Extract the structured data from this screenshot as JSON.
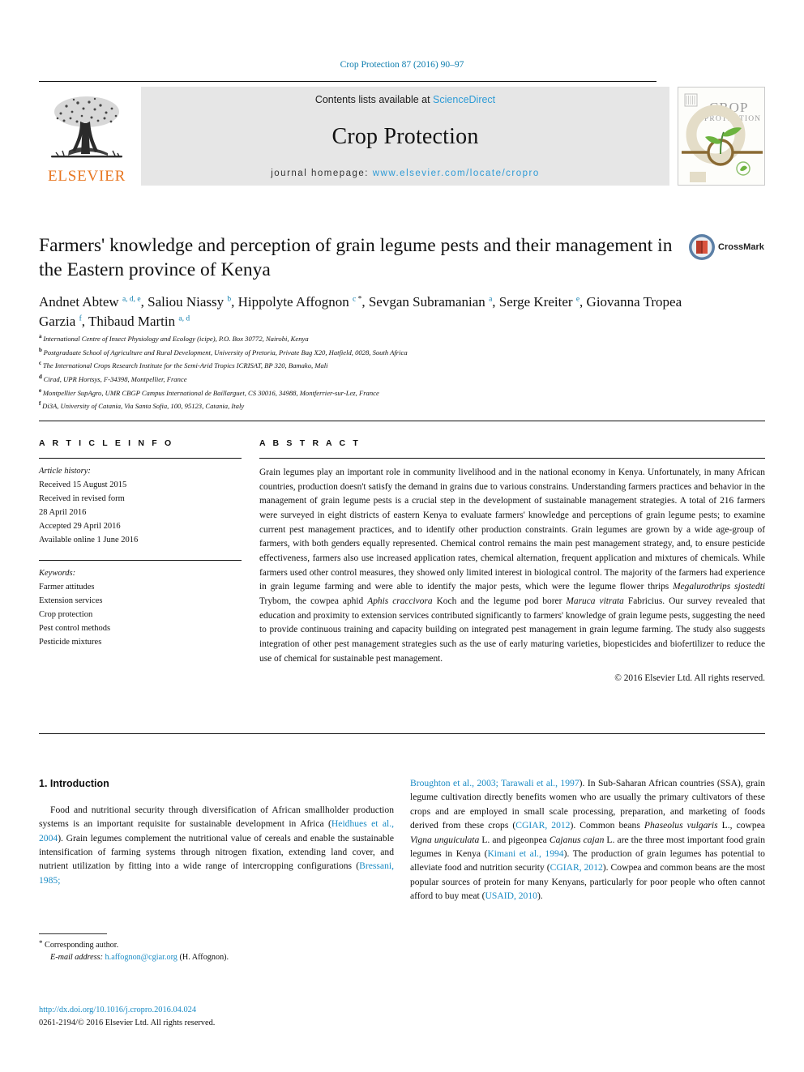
{
  "running_head": "Crop Protection 87 (2016) 90–97",
  "masthead": {
    "contents_prefix": "Contents lists available at ",
    "sciencedirect": "ScienceDirect",
    "journal_name": "Crop Protection",
    "homepage_prefix": "journal homepage: ",
    "homepage_url": "www.elsevier.com/locate/cropro",
    "publisher": "ELSEVIER",
    "cover_title_line1": "CROP",
    "cover_title_line2": "PROTECTION"
  },
  "article": {
    "title": "Farmers' knowledge and perception of grain legume pests and their management in the Eastern province of Kenya",
    "crossmark_label": "CrossMark",
    "authors": [
      {
        "name": "Andnet Abtew",
        "sups": "a, d, e",
        "star": false
      },
      {
        "name": "Saliou Niassy",
        "sups": "b",
        "star": false
      },
      {
        "name": "Hippolyte Affognon",
        "sups": "c",
        "star": true
      },
      {
        "name": "Sevgan Subramanian",
        "sups": "a",
        "star": false
      },
      {
        "name": "Serge Kreiter",
        "sups": "e",
        "star": false
      },
      {
        "name": "Giovanna Tropea Garzia",
        "sups": "f",
        "star": false
      },
      {
        "name": "Thibaud Martin",
        "sups": "a, d",
        "star": false
      }
    ],
    "affiliations": [
      {
        "mark": "a",
        "text": "International Centre of Insect Physiology and Ecology (icipe), P.O. Box 30772, Nairobi, Kenya"
      },
      {
        "mark": "b",
        "text": "Postgraduate School of Agriculture and Rural Development, University of Pretoria, Private Bag X20, Hatfield, 0028, South Africa"
      },
      {
        "mark": "c",
        "text": "The International Crops Research Institute for the Semi-Arid Tropics ICRISAT, BP 320, Bamako, Mali"
      },
      {
        "mark": "d",
        "text": "Cirad, UPR Hortsys, F-34398, Montpellier, France"
      },
      {
        "mark": "e",
        "text": "Montpellier SupAgro, UMR CBGP Campus International de Baillarguet, CS 30016, 34988, Montferrier-sur-Lez, France"
      },
      {
        "mark": "f",
        "text": "Di3A, University of Catania, Via Santa Sofia, 100, 95123, Catania, Italy"
      }
    ]
  },
  "article_info": {
    "heading": "A R T I C L E   I N F O",
    "history_label": "Article history:",
    "history": [
      "Received 15 August 2015",
      "Received in revised form",
      "28 April 2016",
      "Accepted 29 April 2016",
      "Available online 1 June 2016"
    ],
    "keywords_label": "Keywords:",
    "keywords": [
      "Farmer attitudes",
      "Extension services",
      "Crop protection",
      "Pest control methods",
      "Pesticide mixtures"
    ]
  },
  "abstract": {
    "heading": "A B S T R A C T",
    "paragraphs": [
      "Grain legumes play an important role in community livelihood and in the national economy in Kenya. Unfortunately, in many African countries, production doesn't satisfy the demand in grains due to various constrains. Understanding farmers practices and behavior in the management of grain legume pests is a crucial step in the development of sustainable management strategies. A total of 216 farmers were surveyed in eight districts of eastern Kenya to evaluate farmers' knowledge and perceptions of grain legume pests; to examine current pest management practices, and to identify other production constraints. Grain legumes are grown by a wide age-group of farmers, with both genders equally represented. Chemical control remains the main pest management strategy, and, to ensure pesticide effectiveness, farmers also use increased application rates, chemical alternation, frequent application and mixtures of chemicals. While farmers used other control measures, they showed only limited interest in biological control. The majority of the farmers had experience in grain legume farming and were able to identify the major pests, which were the legume flower thrips "
    ],
    "species": [
      "Megalurothrips sjostedti",
      "Aphis craccivora",
      "Maruca vitrata"
    ],
    "tail_1": " Trybom, the cowpea aphid ",
    "tail_2": " Koch and the legume pod borer ",
    "tail_3": " Fabricius. Our survey revealed that education and proximity to extension services contributed significantly to farmers' knowledge of grain legume pests, suggesting the need to provide continuous training and capacity building on integrated pest management in grain legume farming. The study also suggests integration of other pest management strategies such as the use of early maturing varieties, biopesticides and biofertilizer to reduce the use of chemical for sustainable pest management.",
    "copyright": "© 2016 Elsevier Ltd. All rights reserved."
  },
  "introduction": {
    "section_title": "1. Introduction",
    "left_text_1": "Food and nutritional security through diversification of African smallholder production systems is an important requisite for sustainable development in Africa (",
    "cite_heidhues": "Heidhues et al., 2004",
    "left_text_2": "). Grain legumes complement the nutritional value of cereals and enable the sustainable intensification of farming systems through nitrogen fixation, extending land cover, and nutrient utilization by fitting into a wide range of intercropping configurations (",
    "cite_bressani": "Bressani, 1985;",
    "cite_broughton": "Broughton et al., 2003; Tarawali et al., 1997",
    "right_text_1": "). In Sub-Saharan African countries (SSA), grain legume cultivation directly benefits women who are usually the primary cultivators of these crops and are employed in small scale processing, preparation, and marketing of foods derived from these crops (",
    "cite_cgiar_1": "CGIAR, 2012",
    "right_text_2": "). Common beans ",
    "sp_phaseolus": "Phaseolus vulgaris",
    "right_text_3": " L., cowpea ",
    "sp_vigna": "Vigna unguiculata",
    "right_text_4": " L. and pigeonpea ",
    "sp_cajanus": "Cajanus cajan",
    "right_text_5": " L. are the three most important food grain legumes in Kenya (",
    "cite_kimani": "Kimani et al., 1994",
    "right_text_6": "). The production of grain legumes has potential to alleviate food and nutrition security (",
    "cite_cgiar_2": "CGIAR, 2012",
    "right_text_7": "). Cowpea and common beans are the most popular sources of protein for many Kenyans, particularly for poor people who often cannot afford to buy meat (",
    "cite_usaid": "USAID, 2010",
    "right_text_8": ")."
  },
  "footer": {
    "corresponding_star": "*",
    "corresponding_label": "Corresponding author.",
    "email_label": "E-mail address:",
    "email": "h.affognon@cgiar.org",
    "email_owner": "(H. Affognon).",
    "doi": "http://dx.doi.org/10.1016/j.cropro.2016.04.024",
    "issn_line": "0261-2194/© 2016 Elsevier Ltd. All rights reserved."
  },
  "colors": {
    "link": "#1a8bc4",
    "header_blue": "#0b7cad",
    "elsevier_orange": "#E87722",
    "masthead_bg": "#e6e6e6"
  }
}
